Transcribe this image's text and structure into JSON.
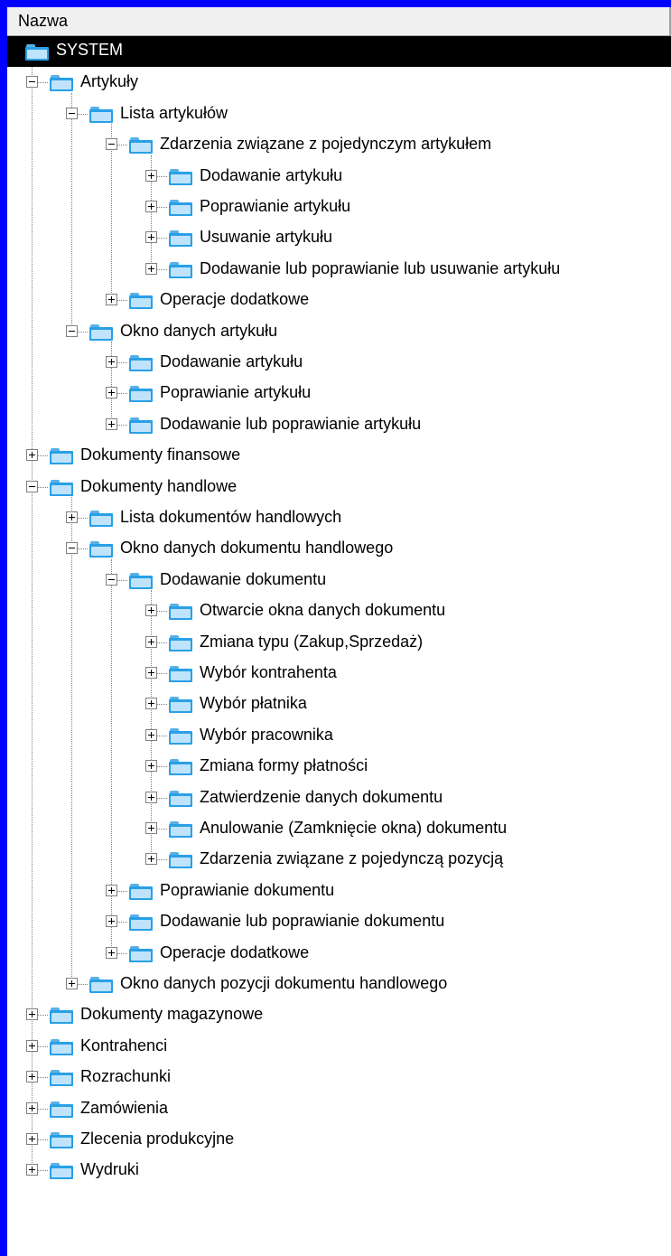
{
  "header": {
    "column_name": "Nazwa"
  },
  "icons": {
    "folder": "folder-icon",
    "expand": "plus-box-icon",
    "collapse": "minus-box-icon"
  },
  "colors": {
    "window_border": "#0000ff",
    "selection": "#000000",
    "folder": "#29a0e6"
  },
  "tree": [
    {
      "label": "SYSTEM",
      "level": 0,
      "toggle": null,
      "selected": true
    },
    {
      "label": "Artykuły",
      "level": 1,
      "toggle": "minus"
    },
    {
      "label": "Lista artykułów",
      "level": 2,
      "toggle": "minus"
    },
    {
      "label": "Zdarzenia związane z pojedynczym artykułem",
      "level": 3,
      "toggle": "minus"
    },
    {
      "label": "Dodawanie artykułu",
      "level": 4,
      "toggle": "plus"
    },
    {
      "label": "Poprawianie artykułu",
      "level": 4,
      "toggle": "plus"
    },
    {
      "label": "Usuwanie artykułu",
      "level": 4,
      "toggle": "plus"
    },
    {
      "label": "Dodawanie lub poprawianie lub usuwanie artykułu",
      "level": 4,
      "toggle": "plus"
    },
    {
      "label": "Operacje dodatkowe",
      "level": 3,
      "toggle": "plus"
    },
    {
      "label": "Okno danych artykułu",
      "level": 2,
      "toggle": "minus"
    },
    {
      "label": "Dodawanie artykułu",
      "level": 3,
      "toggle": "plus"
    },
    {
      "label": "Poprawianie artykułu",
      "level": 3,
      "toggle": "plus"
    },
    {
      "label": "Dodawanie lub poprawianie artykułu",
      "level": 3,
      "toggle": "plus"
    },
    {
      "label": "Dokumenty finansowe",
      "level": 1,
      "toggle": "plus"
    },
    {
      "label": "Dokumenty handlowe",
      "level": 1,
      "toggle": "minus"
    },
    {
      "label": "Lista dokumentów handlowych",
      "level": 2,
      "toggle": "plus"
    },
    {
      "label": "Okno danych dokumentu handlowego",
      "level": 2,
      "toggle": "minus"
    },
    {
      "label": "Dodawanie dokumentu",
      "level": 3,
      "toggle": "minus"
    },
    {
      "label": "Otwarcie okna danych dokumentu",
      "level": 4,
      "toggle": "plus"
    },
    {
      "label": "Zmiana typu (Zakup,Sprzedaż)",
      "level": 4,
      "toggle": "plus"
    },
    {
      "label": "Wybór kontrahenta",
      "level": 4,
      "toggle": "plus"
    },
    {
      "label": "Wybór płatnika",
      "level": 4,
      "toggle": "plus"
    },
    {
      "label": "Wybór pracownika",
      "level": 4,
      "toggle": "plus"
    },
    {
      "label": "Zmiana formy płatności",
      "level": 4,
      "toggle": "plus"
    },
    {
      "label": "Zatwierdzenie danych dokumentu",
      "level": 4,
      "toggle": "plus"
    },
    {
      "label": "Anulowanie (Zamknięcie okna) dokumentu",
      "level": 4,
      "toggle": "plus"
    },
    {
      "label": "Zdarzenia związane z pojedynczą pozycją",
      "level": 4,
      "toggle": "plus"
    },
    {
      "label": "Poprawianie dokumentu",
      "level": 3,
      "toggle": "plus"
    },
    {
      "label": "Dodawanie lub poprawianie dokumentu",
      "level": 3,
      "toggle": "plus"
    },
    {
      "label": "Operacje dodatkowe",
      "level": 3,
      "toggle": "plus"
    },
    {
      "label": "Okno danych pozycji dokumentu handlowego",
      "level": 2,
      "toggle": "plus"
    },
    {
      "label": "Dokumenty magazynowe",
      "level": 1,
      "toggle": "plus"
    },
    {
      "label": "Kontrahenci",
      "level": 1,
      "toggle": "plus"
    },
    {
      "label": "Rozrachunki",
      "level": 1,
      "toggle": "plus"
    },
    {
      "label": "Zamówienia",
      "level": 1,
      "toggle": "plus"
    },
    {
      "label": "Zlecenia produkcyjne",
      "level": 1,
      "toggle": "plus"
    },
    {
      "label": "Wydruki",
      "level": 1,
      "toggle": "plus"
    }
  ]
}
